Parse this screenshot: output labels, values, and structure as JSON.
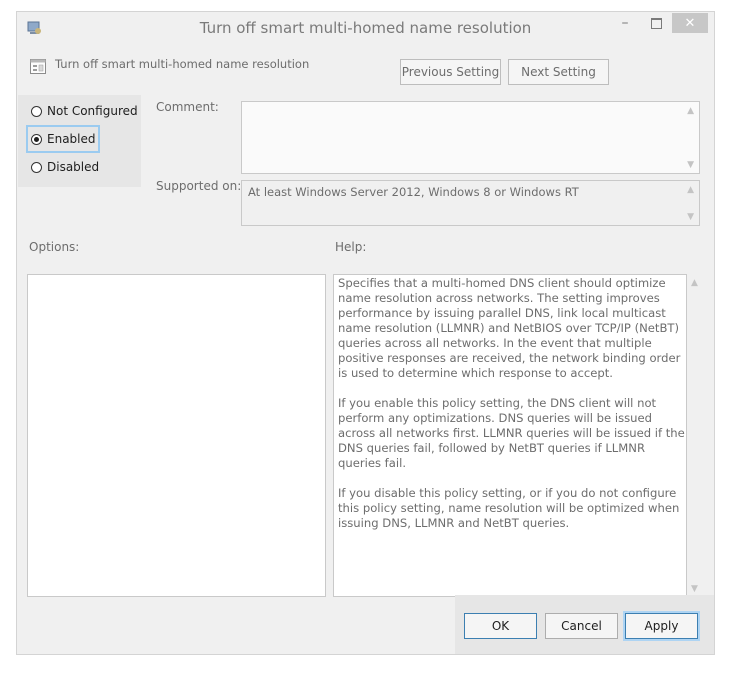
{
  "window": {
    "title": "Turn off smart multi-homed name resolution",
    "controls": {
      "minimize": "–",
      "close": "✕"
    }
  },
  "header": {
    "policy_name": "Turn off smart multi-homed name resolution",
    "previous_label": "Previous Setting",
    "next_label": "Next Setting"
  },
  "state": {
    "options": [
      {
        "label": "Not Configured",
        "selected": false
      },
      {
        "label": "Enabled",
        "selected": true
      },
      {
        "label": "Disabled",
        "selected": false
      }
    ]
  },
  "comment": {
    "label": "Comment:",
    "value": ""
  },
  "supported": {
    "label": "Supported on:",
    "value": "At least Windows Server 2012, Windows 8 or Windows RT"
  },
  "options_section": {
    "label": "Options:"
  },
  "help": {
    "label": "Help:",
    "paragraphs": [
      "Specifies that a multi-homed DNS client should optimize name resolution across networks.  The setting improves performance by issuing parallel DNS, link local multicast name resolution (LLMNR) and NetBIOS over TCP/IP (NetBT) queries across all networks. In the event that multiple positive responses are received, the network binding order is used to determine which response to accept.",
      "If you enable this policy setting, the DNS client will not perform any optimizations.  DNS queries will be issued across all networks first. LLMNR queries will be issued if the DNS queries fail, followed by NetBT queries if LLMNR queries fail.",
      "If you disable this policy setting, or if you do not configure this policy setting, name resolution will be optimized when issuing DNS, LLMNR and NetBT queries."
    ]
  },
  "footer": {
    "ok_label": "OK",
    "cancel_label": "Cancel",
    "apply_label": "Apply"
  },
  "colors": {
    "accent_border": "#3c7fb1",
    "focus_glow": "#9bcbf0",
    "close_button": "#c7c7c7"
  },
  "icons": [
    "app-icon",
    "policy-setting-icon",
    "minimize-icon",
    "maximize-icon",
    "close-icon",
    "scroll-up-icon",
    "scroll-down-icon"
  ]
}
